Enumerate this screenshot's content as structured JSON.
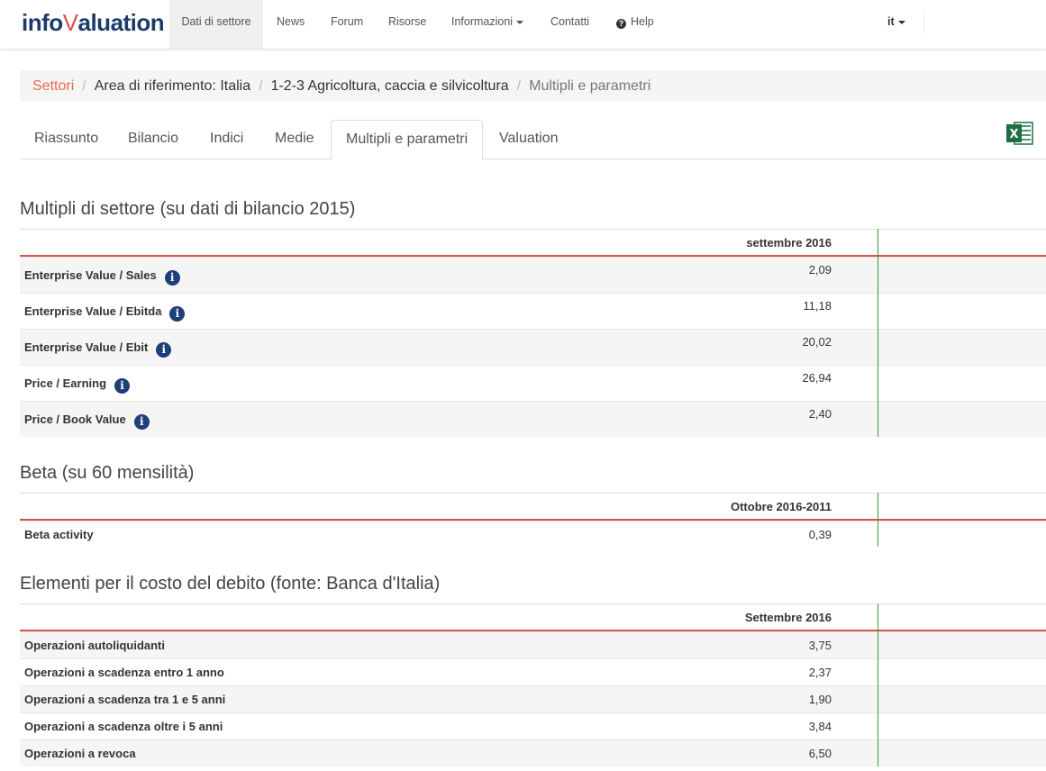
{
  "brand": {
    "prefix": "info",
    "v": "V",
    "suffix": "aluation"
  },
  "nav": {
    "items": [
      {
        "label": "Dati di settore"
      },
      {
        "label": "News"
      },
      {
        "label": "Forum"
      },
      {
        "label": "Risorse"
      },
      {
        "label": "Informazioni"
      },
      {
        "label": "Contatti"
      },
      {
        "label": "Help"
      }
    ],
    "lang": "it"
  },
  "breadcrumb": {
    "items": [
      "Settori",
      "Area di riferimento: Italia",
      "1-2-3 Agricoltura, caccia e silvicoltura",
      "Multipli e parametri"
    ],
    "sep": "/"
  },
  "tabs": [
    "Riassunto",
    "Bilancio",
    "Indici",
    "Medie",
    "Multipli e parametri",
    "Valuation"
  ],
  "active_tab": "Multipli e parametri",
  "excel_icon": "excel-icon",
  "colors": {
    "accent": "#d9534f",
    "brand": "#1e3a6b",
    "link": "#e46a4e",
    "divider": "#3a9a3a",
    "info": "#1e3f7a"
  },
  "multipli": {
    "title": "Multipli di settore (su dati di bilancio 2015)",
    "column": "settembre 2016",
    "rows": [
      {
        "name": "Enterprise Value / Sales",
        "value": "2,09"
      },
      {
        "name": "Enterprise Value / Ebitda",
        "value": "11,18"
      },
      {
        "name": "Enterprise Value / Ebit",
        "value": "20,02"
      },
      {
        "name": "Price / Earning",
        "value": "26,94"
      },
      {
        "name": "Price / Book Value",
        "value": "2,40"
      }
    ]
  },
  "beta": {
    "title": "Beta (su 60 mensilità)",
    "column": "Ottobre 2016-2011",
    "rows": [
      {
        "name": "Beta activity",
        "value": "0,39"
      }
    ]
  },
  "debito": {
    "title": "Elementi per il costo del debito (fonte: Banca d'Italia)",
    "column": "Settembre 2016",
    "rows": [
      {
        "name": "Operazioni autoliquidanti",
        "value": "3,75"
      },
      {
        "name": "Operazioni a scadenza entro 1 anno",
        "value": "2,37"
      },
      {
        "name": "Operazioni a scadenza tra 1 e 5 anni",
        "value": "1,90"
      },
      {
        "name": "Operazioni a scadenza oltre i 5 anni",
        "value": "3,84"
      },
      {
        "name": "Operazioni a revoca",
        "value": "6,50"
      }
    ]
  }
}
